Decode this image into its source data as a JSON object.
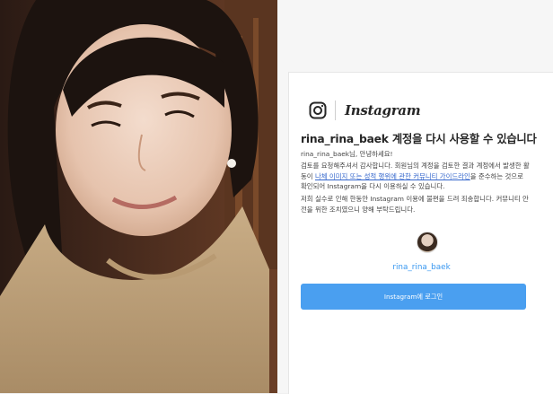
{
  "photo": {
    "alt_subject": "selfie"
  },
  "card": {
    "brand": "Instagram",
    "title": "rina_rina_baek 계정을 다시 사용할 수 있습니다",
    "greeting": "rina_rina_baek님, 안녕하세요!",
    "p1_before": "검토를 요청해주셔서 감사합니다. 회원님의 계정을 검토한 결과 계정에서 발생한 활동이 ",
    "p1_link": "나체 이미지 또는 성적 행위에 관한 커뮤니티 가이드라인",
    "p1_after": "을 준수하는 것으로 확인되어 Instagram을 다시 이용하실 수 있습니다.",
    "p2": "저희 실수로 인해 한동안 Instagram 이용에 불편을 드려 죄송합니다. 커뮤니티 안전을 위한 조치였으니 양해 부탁드립니다.",
    "username": "rina_rina_baek",
    "login_button": "Instagram에 로그인"
  },
  "colors": {
    "link": "#3366cc",
    "username": "#3897f0",
    "button": "#4a9ff0"
  }
}
